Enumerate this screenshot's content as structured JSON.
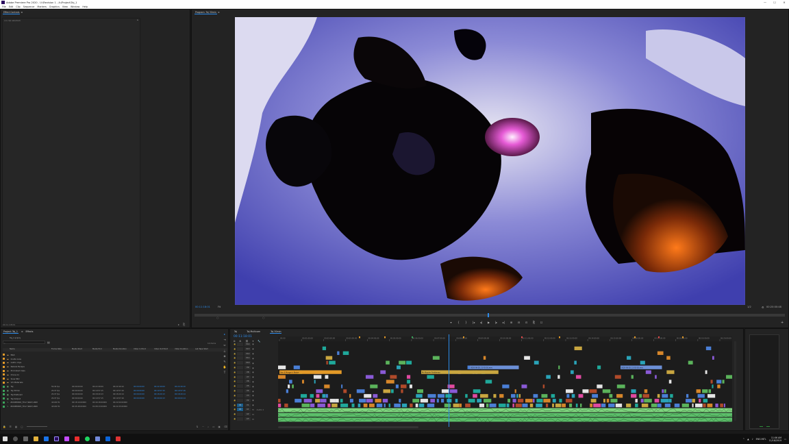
{
  "window": {
    "title": "Adobe Premiere Pro 2020 - U:\\Revision 1 - A:\\Project\\Taj_1",
    "controls": [
      "—",
      "☐",
      "✕"
    ]
  },
  "menu": [
    "File",
    "Edit",
    "Clip",
    "Sequence",
    "Markers",
    "Graphics",
    "View",
    "Window",
    "Help"
  ],
  "effect_controls": {
    "tab": "Effect Controls",
    "tab_menu": "≡",
    "message": "(no clip selected)",
    "timecode": "00:11:18:01"
  },
  "program_monitor": {
    "tab": "Program: Taj 30min",
    "tab_menu": "≡",
    "timecode": "00:11:18:01",
    "fit": "Fit",
    "quality": "1/2",
    "duration": "00:20:00:48",
    "transport": [
      "▾",
      "{",
      "}",
      "|◂",
      "◂|",
      "▶",
      "|▸",
      "▸|",
      "⊞",
      "⊟",
      "⊡",
      "⎘",
      "☐"
    ]
  },
  "project": {
    "tabs": [
      "Project: Taj_1",
      "Effects"
    ],
    "tab_menu": "≡",
    "path": "Taj_1.prproj",
    "item_count": "14 items",
    "columns": [
      "Name",
      "Frame Rate",
      "Media Start",
      "Media End",
      "Media Duration",
      "Video In Point",
      "Video Out Point",
      "Video Duration",
      "Lab Tape Start"
    ],
    "rows": [
      {
        "name": "B&S",
        "color": "#e39a28",
        "type": "bin"
      },
      {
        "name": "Inside Loss",
        "color": "#e39a28",
        "type": "bin"
      },
      {
        "name": "GoPro clips",
        "color": "#e39a28",
        "type": "bin"
      },
      {
        "name": "Rebels Escape",
        "color": "#e39a28",
        "type": "bin"
      },
      {
        "name": "Promoted Clips",
        "color": "#e39a28",
        "type": "bin"
      },
      {
        "name": "Drone b)",
        "color": "#e39a28",
        "type": "bin"
      },
      {
        "name": "Slow Mtd",
        "color": "#e39a28",
        "type": "bin"
      },
      {
        "name": "VO Materials",
        "color": "#e39a28",
        "type": "bin"
      },
      {
        "name": "Taj",
        "color": "#3aa55b",
        "type": "seq",
        "fps": "59.94 fps",
        "start": "00:00:00:00",
        "end": "00:22:49:09",
        "dur": "00:22:49:10",
        "in": "00:00:00:00",
        "out": "00:22:49:09",
        "vdur": "00:22:49:10"
      },
      {
        "name": "Taj 30min",
        "color": "#3aa55b",
        "type": "seq",
        "fps": "29.97 fps",
        "start": "00:00:00:00",
        "end": "00:19:57:15",
        "dur": "00:19:57:16",
        "in": "00:00:00:00",
        "out": "00:19:57:15",
        "vdur": "00:19:57:16"
      },
      {
        "name": "Taj Multicam",
        "color": "#3aa55b",
        "type": "seq",
        "fps": "29.97 fps",
        "start": "00:00:00:00",
        "end": "00:18:20:13",
        "dur": "00:18:20:14",
        "in": "00:00:00:00",
        "out": "00:18:20:13",
        "vdur": "00:18:20:14"
      },
      {
        "name": "Taj Output",
        "color": "#3aa55b",
        "type": "seq",
        "fps": "29.97 fps",
        "start": "00:00:00:00",
        "end": "00:19:57:15",
        "dur": "00:19:57:16",
        "in": "00:00:00:00",
        "out": "00:00:00:13",
        "vdur": "00:00:00:14"
      },
      {
        "name": "ZOOM0002_Tr12 (WAV).WAV",
        "color": "#3aa55b",
        "type": "aud",
        "fps": "44100 Hz",
        "start": "00:18:19:00009",
        "end": "00:40:18:00009",
        "dur": "00:22:00:00000",
        "in": "",
        "out": "",
        "vdur": ""
      },
      {
        "name": "ZOOM0003_Tr12 (WAV).WAV",
        "color": "#3aa55b",
        "type": "aud",
        "fps": "44100 Hz",
        "start": "00:45:48:00009",
        "end": "01:08:13:00009",
        "dur": "00:22:25:00000",
        "in": "",
        "out": "",
        "vdur": ""
      }
    ]
  },
  "timeline": {
    "tabs": [
      "Taj",
      "Taj Multicam",
      "Taj 30min"
    ],
    "active_tab": "Taj 30min",
    "timecode": "00:11:18:01",
    "ruler": [
      "00:00",
      "00:01:00:00",
      "00:02:00:00",
      "00:03:00:00",
      "00:04:00:00",
      "00:05:00:00",
      "00:06:00:00",
      "00:07:00:00",
      "00:08:00:00",
      "00:09:00:00",
      "00:10:00:00",
      "00:11:00:00",
      "00:12:00:00",
      "00:13:00:00",
      "00:14:00:00",
      "00:15:00:00",
      "00:16:00:00",
      "00:17:00:00",
      "00:18:00:00",
      "00:19:00:00",
      "00:20:00:00"
    ],
    "tracks": [
      {
        "name": "V14",
        "src": false
      },
      {
        "name": "V13",
        "src": false
      },
      {
        "name": "V12",
        "src": false
      },
      {
        "name": "V11",
        "src": false
      },
      {
        "name": "V10",
        "src": false
      },
      {
        "name": "V9",
        "src": false
      },
      {
        "name": "V8",
        "src": false
      },
      {
        "name": "V7",
        "src": false
      },
      {
        "name": "V6",
        "src": false
      },
      {
        "name": "V5",
        "src": false
      },
      {
        "name": "V4",
        "src": false
      },
      {
        "name": "V3",
        "src": false
      },
      {
        "name": "V2",
        "src": false
      },
      {
        "name": "V1",
        "src": true
      },
      {
        "name": "A1",
        "src": true
      },
      {
        "name": "A2",
        "src": false
      },
      {
        "name": "A3",
        "src": false
      }
    ],
    "clip_labels": [
      "Dan & Morgan's Rental",
      "Mr Murphy Gentleman",
      "2020-06-20_11-01-16.mov",
      "2020-06-20_11-01-16.mov"
    ],
    "audio_label": "Audio 1"
  },
  "tools": [
    "▸",
    "⇥",
    "⇔",
    "⟂",
    "◈",
    "✎",
    "✋",
    "T"
  ],
  "taskbar": {
    "apps": [
      "windows",
      "search",
      "task-view",
      "explorer",
      "chrome",
      "premiere",
      "after-effects",
      "premiere-rush",
      "photos",
      "spotify",
      "discord",
      "settings"
    ],
    "time": "11:06 AM",
    "date": "11/16/2019",
    "lang": "ENG INTL"
  },
  "colors": {
    "accent": "#2d8ceb",
    "bin": "#e39a28",
    "sequence": "#3aa55b"
  }
}
